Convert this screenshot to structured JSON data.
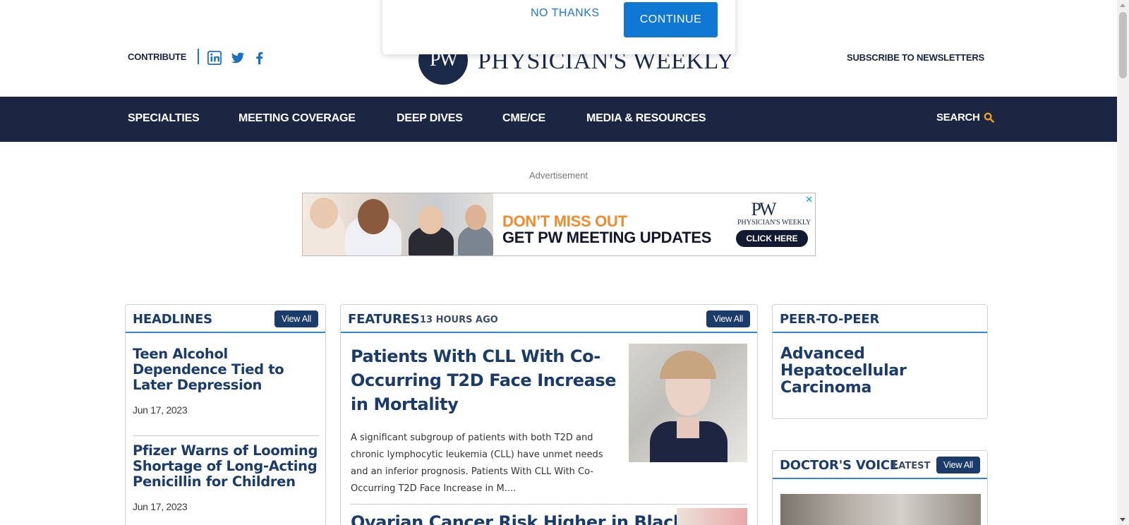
{
  "header": {
    "contribute": "CONTRIBUTE",
    "social": [
      "linkedin-icon",
      "twitter-icon",
      "facebook-icon"
    ],
    "logo_mark": "PW",
    "logo_text": "PHYSICIAN'S WEEKLY",
    "subscribe": "SUBSCRIBE TO NEWSLETTERS"
  },
  "popup": {
    "no_thanks": "NO THANKS",
    "continue": "CONTINUE"
  },
  "nav": {
    "items": [
      "SPECIALTIES",
      "MEETING COVERAGE",
      "DEEP DIVES",
      "CME/CE",
      "MEDIA & RESOURCES"
    ],
    "search": "SEARCH"
  },
  "ad": {
    "label": "Advertisement",
    "line1": "DON’T MISS OUT",
    "line2": "GET PW MEETING UPDATES",
    "logo_mark": "PW",
    "logo_text": "PHYSICIAN'S WEEKLY",
    "cta": "CLICK HERE"
  },
  "headlines": {
    "title": "HEADLINES",
    "view_all": "View All",
    "items": [
      {
        "title": "Teen Alcohol Dependence Tied to Later Depression",
        "date": "Jun 17, 2023"
      },
      {
        "title": "Pfizer Warns of Looming Shortage of Long-Acting Penicillin for Children",
        "date": "Jun 17, 2023"
      }
    ]
  },
  "features": {
    "title": "FEATURES",
    "time": "13 HOURS AGO",
    "view_all": "View All",
    "main": {
      "title": "Patients With CLL With Co-Occurring T2D Face Increase in Mortality",
      "description": "A significant subgroup of patients with both T2D and chronic lymphocytic leukemia (CLL) have unmet needs and an inferior prognosis. Patients With CLL With Co-Occurring T2D Face Increase in M...."
    },
    "second_title": "Ovarian Cancer Risk Higher in Black"
  },
  "peer": {
    "title": "PEER-TO-PEER",
    "item": "Advanced Hepatocellular Carcinoma"
  },
  "doctors_voice": {
    "title": "DOCTOR'S VOICE",
    "sub": "LATEST",
    "view_all": "View All"
  },
  "colors": {
    "navy": "#1b2642",
    "accent_blue": "#0f78d4",
    "heading_blue": "#1b3b6b",
    "search_icon": "#f3a21c",
    "ad_orange": "#f08a2b"
  }
}
